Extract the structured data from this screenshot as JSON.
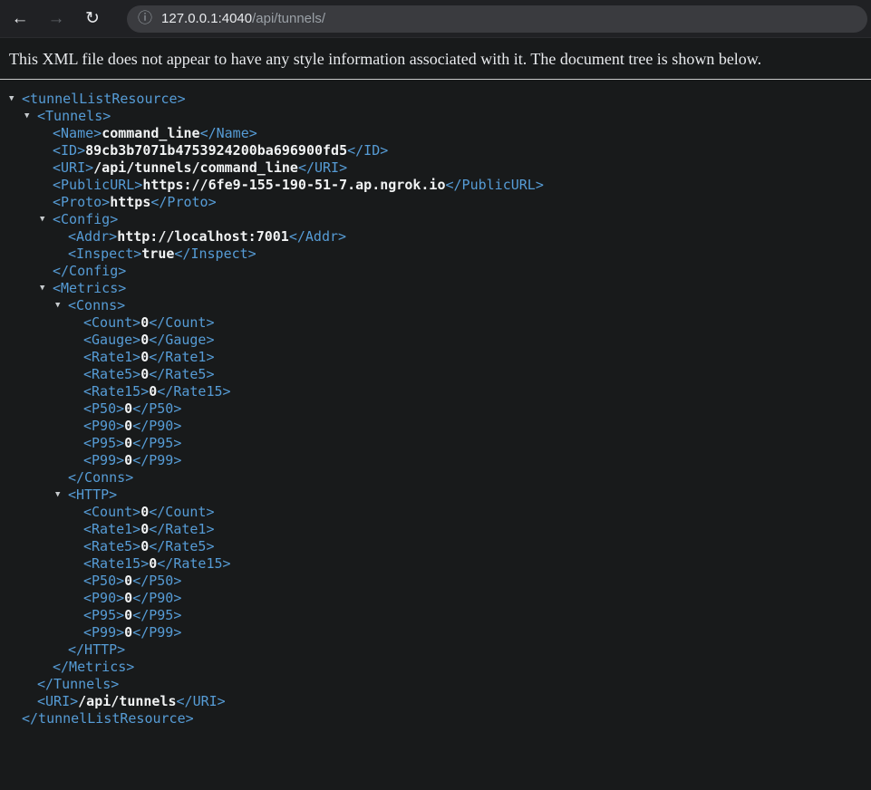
{
  "browser": {
    "back_glyph": "←",
    "forward_glyph": "→",
    "reload_glyph": "↻",
    "info_glyph": "ⓘ",
    "url_host": "127.0.0.1:4040",
    "url_path": "/api/tunnels/"
  },
  "page": {
    "notice": "This XML file does not appear to have any style information associated with it. The document tree is shown below."
  },
  "colors": {
    "toolbar_bg": "#202124",
    "omnibox_bg": "#3a3b3f",
    "page_bg": "#181a1b",
    "tag_color": "#569cd6",
    "text_color": "#f1f3f4"
  },
  "xml_tree": {
    "arrow_glyph": "▼",
    "lines": [
      {
        "indent": 0,
        "arrow": true,
        "parts": [
          [
            "tag",
            "<tunnelListResource>"
          ]
        ]
      },
      {
        "indent": 1,
        "arrow": true,
        "parts": [
          [
            "tag",
            "<Tunnels>"
          ]
        ]
      },
      {
        "indent": 2,
        "arrow": false,
        "parts": [
          [
            "tag",
            "<Name>"
          ],
          [
            "text",
            "command_line"
          ],
          [
            "tag",
            "</Name>"
          ]
        ]
      },
      {
        "indent": 2,
        "arrow": false,
        "parts": [
          [
            "tag",
            "<ID>"
          ],
          [
            "text",
            "89cb3b7071b4753924200ba696900fd5"
          ],
          [
            "tag",
            "</ID>"
          ]
        ]
      },
      {
        "indent": 2,
        "arrow": false,
        "parts": [
          [
            "tag",
            "<URI>"
          ],
          [
            "text",
            "/api/tunnels/command_line"
          ],
          [
            "tag",
            "</URI>"
          ]
        ]
      },
      {
        "indent": 2,
        "arrow": false,
        "parts": [
          [
            "tag",
            "<PublicURL>"
          ],
          [
            "text",
            "https://6fe9-155-190-51-7.ap.ngrok.io"
          ],
          [
            "tag",
            "</PublicURL>"
          ]
        ]
      },
      {
        "indent": 2,
        "arrow": false,
        "parts": [
          [
            "tag",
            "<Proto>"
          ],
          [
            "text",
            "https"
          ],
          [
            "tag",
            "</Proto>"
          ]
        ]
      },
      {
        "indent": 2,
        "arrow": true,
        "parts": [
          [
            "tag",
            "<Config>"
          ]
        ]
      },
      {
        "indent": 3,
        "arrow": false,
        "parts": [
          [
            "tag",
            "<Addr>"
          ],
          [
            "text",
            "http://localhost:7001"
          ],
          [
            "tag",
            "</Addr>"
          ]
        ]
      },
      {
        "indent": 3,
        "arrow": false,
        "parts": [
          [
            "tag",
            "<Inspect>"
          ],
          [
            "text",
            "true"
          ],
          [
            "tag",
            "</Inspect>"
          ]
        ]
      },
      {
        "indent": 2,
        "arrow": false,
        "parts": [
          [
            "tag",
            "</Config>"
          ]
        ]
      },
      {
        "indent": 2,
        "arrow": true,
        "parts": [
          [
            "tag",
            "<Metrics>"
          ]
        ]
      },
      {
        "indent": 3,
        "arrow": true,
        "parts": [
          [
            "tag",
            "<Conns>"
          ]
        ]
      },
      {
        "indent": 4,
        "arrow": false,
        "parts": [
          [
            "tag",
            "<Count>"
          ],
          [
            "text",
            "0"
          ],
          [
            "tag",
            "</Count>"
          ]
        ]
      },
      {
        "indent": 4,
        "arrow": false,
        "parts": [
          [
            "tag",
            "<Gauge>"
          ],
          [
            "text",
            "0"
          ],
          [
            "tag",
            "</Gauge>"
          ]
        ]
      },
      {
        "indent": 4,
        "arrow": false,
        "parts": [
          [
            "tag",
            "<Rate1>"
          ],
          [
            "text",
            "0"
          ],
          [
            "tag",
            "</Rate1>"
          ]
        ]
      },
      {
        "indent": 4,
        "arrow": false,
        "parts": [
          [
            "tag",
            "<Rate5>"
          ],
          [
            "text",
            "0"
          ],
          [
            "tag",
            "</Rate5>"
          ]
        ]
      },
      {
        "indent": 4,
        "arrow": false,
        "parts": [
          [
            "tag",
            "<Rate15>"
          ],
          [
            "text",
            "0"
          ],
          [
            "tag",
            "</Rate15>"
          ]
        ]
      },
      {
        "indent": 4,
        "arrow": false,
        "parts": [
          [
            "tag",
            "<P50>"
          ],
          [
            "text",
            "0"
          ],
          [
            "tag",
            "</P50>"
          ]
        ]
      },
      {
        "indent": 4,
        "arrow": false,
        "parts": [
          [
            "tag",
            "<P90>"
          ],
          [
            "text",
            "0"
          ],
          [
            "tag",
            "</P90>"
          ]
        ]
      },
      {
        "indent": 4,
        "arrow": false,
        "parts": [
          [
            "tag",
            "<P95>"
          ],
          [
            "text",
            "0"
          ],
          [
            "tag",
            "</P95>"
          ]
        ]
      },
      {
        "indent": 4,
        "arrow": false,
        "parts": [
          [
            "tag",
            "<P99>"
          ],
          [
            "text",
            "0"
          ],
          [
            "tag",
            "</P99>"
          ]
        ]
      },
      {
        "indent": 3,
        "arrow": false,
        "parts": [
          [
            "tag",
            "</Conns>"
          ]
        ]
      },
      {
        "indent": 3,
        "arrow": true,
        "parts": [
          [
            "tag",
            "<HTTP>"
          ]
        ]
      },
      {
        "indent": 4,
        "arrow": false,
        "parts": [
          [
            "tag",
            "<Count>"
          ],
          [
            "text",
            "0"
          ],
          [
            "tag",
            "</Count>"
          ]
        ]
      },
      {
        "indent": 4,
        "arrow": false,
        "parts": [
          [
            "tag",
            "<Rate1>"
          ],
          [
            "text",
            "0"
          ],
          [
            "tag",
            "</Rate1>"
          ]
        ]
      },
      {
        "indent": 4,
        "arrow": false,
        "parts": [
          [
            "tag",
            "<Rate5>"
          ],
          [
            "text",
            "0"
          ],
          [
            "tag",
            "</Rate5>"
          ]
        ]
      },
      {
        "indent": 4,
        "arrow": false,
        "parts": [
          [
            "tag",
            "<Rate15>"
          ],
          [
            "text",
            "0"
          ],
          [
            "tag",
            "</Rate15>"
          ]
        ]
      },
      {
        "indent": 4,
        "arrow": false,
        "parts": [
          [
            "tag",
            "<P50>"
          ],
          [
            "text",
            "0"
          ],
          [
            "tag",
            "</P50>"
          ]
        ]
      },
      {
        "indent": 4,
        "arrow": false,
        "parts": [
          [
            "tag",
            "<P90>"
          ],
          [
            "text",
            "0"
          ],
          [
            "tag",
            "</P90>"
          ]
        ]
      },
      {
        "indent": 4,
        "arrow": false,
        "parts": [
          [
            "tag",
            "<P95>"
          ],
          [
            "text",
            "0"
          ],
          [
            "tag",
            "</P95>"
          ]
        ]
      },
      {
        "indent": 4,
        "arrow": false,
        "parts": [
          [
            "tag",
            "<P99>"
          ],
          [
            "text",
            "0"
          ],
          [
            "tag",
            "</P99>"
          ]
        ]
      },
      {
        "indent": 3,
        "arrow": false,
        "parts": [
          [
            "tag",
            "</HTTP>"
          ]
        ]
      },
      {
        "indent": 2,
        "arrow": false,
        "parts": [
          [
            "tag",
            "</Metrics>"
          ]
        ]
      },
      {
        "indent": 1,
        "arrow": false,
        "parts": [
          [
            "tag",
            "</Tunnels>"
          ]
        ]
      },
      {
        "indent": 1,
        "arrow": false,
        "parts": [
          [
            "tag",
            "<URI>"
          ],
          [
            "text",
            "/api/tunnels"
          ],
          [
            "tag",
            "</URI>"
          ]
        ]
      },
      {
        "indent": 0,
        "arrow": false,
        "parts": [
          [
            "tag",
            "</tunnelListResource>"
          ]
        ]
      }
    ]
  }
}
